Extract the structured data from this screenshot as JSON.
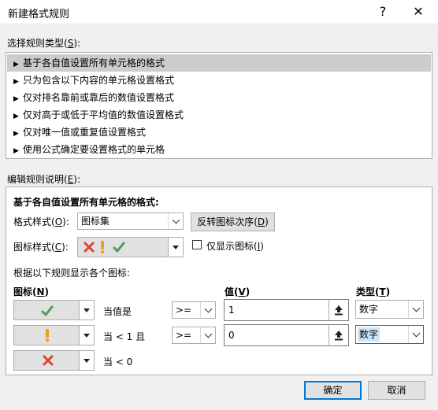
{
  "window": {
    "title": "新建格式规则",
    "help_label": "?",
    "close_label": "✕"
  },
  "rule_type": {
    "label_prefix": "选择规则类型(",
    "label_key": "S",
    "label_suffix": "):",
    "items": [
      {
        "label": "基于各自值设置所有单元格的格式",
        "selected": true
      },
      {
        "label": "只为包含以下内容的单元格设置格式",
        "selected": false
      },
      {
        "label": "仅对排名靠前或靠后的数值设置格式",
        "selected": false
      },
      {
        "label": "仅对高于或低于平均值的数值设置格式",
        "selected": false
      },
      {
        "label": "仅对唯一值或重复值设置格式",
        "selected": false
      },
      {
        "label": "使用公式确定要设置格式的单元格",
        "selected": false
      }
    ]
  },
  "edit": {
    "label_prefix": "编辑规则说明(",
    "label_key": "E",
    "label_suffix": "):",
    "heading": "基于各自值设置所有单元格的格式:",
    "format_style_label": "格式样式(",
    "format_style_key": "O",
    "format_style_value": "图标集",
    "reverse_button": "反转图标次序(",
    "reverse_key": "D",
    "icon_style_label": "图标样式(",
    "icon_style_key": "C",
    "show_icon_only_label": "仅显示图标(",
    "show_icon_only_key": "I",
    "show_icon_only_checked": false,
    "rules_caption": "根据以下规则显示各个图标:",
    "col_icon": "图标(",
    "col_icon_key": "N",
    "col_value": "值(",
    "col_value_key": "V",
    "col_type": "类型(",
    "col_type_key": "T",
    "close_paren": ")",
    "close_paren_colon": "):",
    "rows": [
      {
        "icon": "check-icon",
        "condition": "当值是",
        "operator": ">=",
        "value": "1",
        "type": "数字"
      },
      {
        "icon": "exclamation-icon",
        "condition": "当 < 1 且",
        "operator": ">=",
        "value": "0",
        "type": "数字"
      },
      {
        "icon": "cross-icon",
        "condition": "当 < 0"
      }
    ]
  },
  "footer": {
    "ok_label": "确定",
    "cancel_label": "取消"
  },
  "colors": {
    "check": "#4e9a5a",
    "exclamation": "#e8a317",
    "cross": "#d9442e",
    "selection": "#cccccc",
    "type_selected": "#cce4f7"
  }
}
